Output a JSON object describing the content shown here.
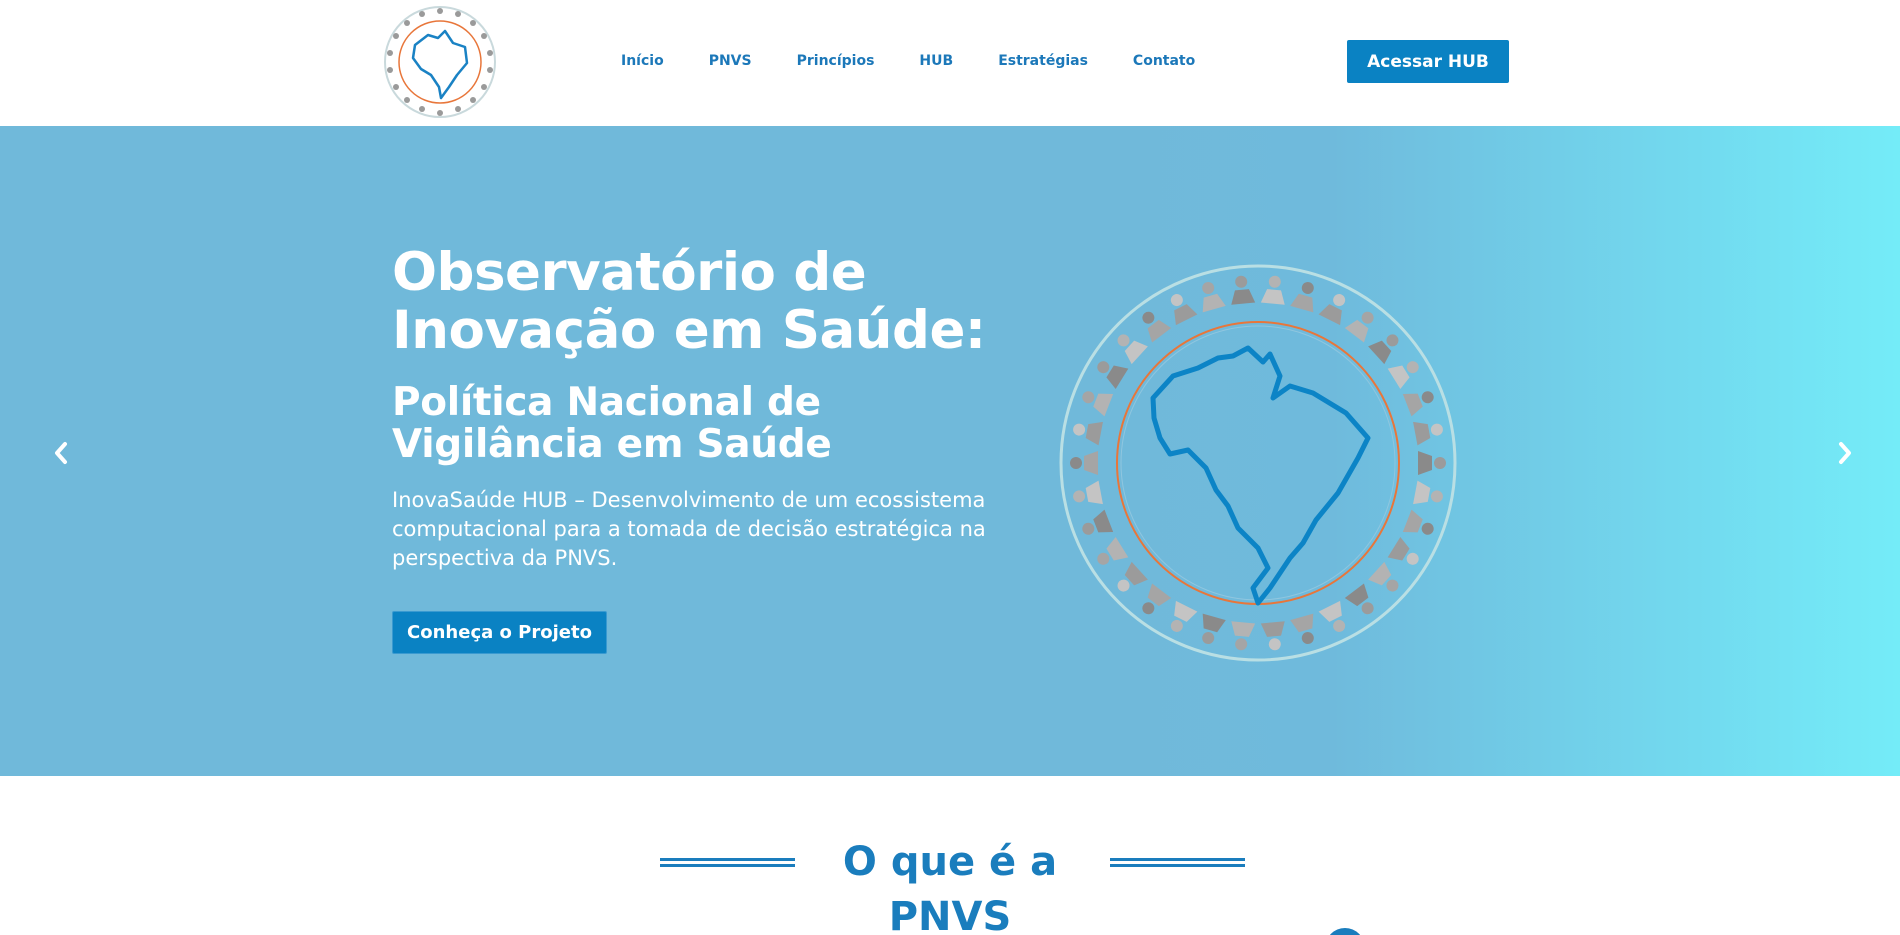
{
  "header": {
    "logo_icon": "brazil-map-people-circle-logo",
    "nav_items": [
      "Início",
      "PNVS",
      "Princípios",
      "HUB",
      "Estratégias",
      "Contato"
    ],
    "cta_label": "Acessar HUB"
  },
  "hero": {
    "title": "Observatório de Inovação em Saúde:",
    "subtitle": "Política Nacional de Vigilância em Saúde",
    "description": "InovaSaúde HUB – Desenvolvimento de um ecossistema computacional para a tomada de decisão estratégica na perspectiva da PNVS.",
    "button_label": "Conheça o Projeto",
    "prev_icon": "chevron-left-icon",
    "next_icon": "chevron-right-icon",
    "image_icon": "brazil-map-people-circle-illustration"
  },
  "section": {
    "title": "O que é a PNVS"
  },
  "colors": {
    "brand_blue": "#0a82c3",
    "nav_text": "#1c78b9",
    "hero_bg_start": "#70b9da",
    "hero_bg_end": "#74ecf8",
    "accent_orange": "#e8763a"
  }
}
